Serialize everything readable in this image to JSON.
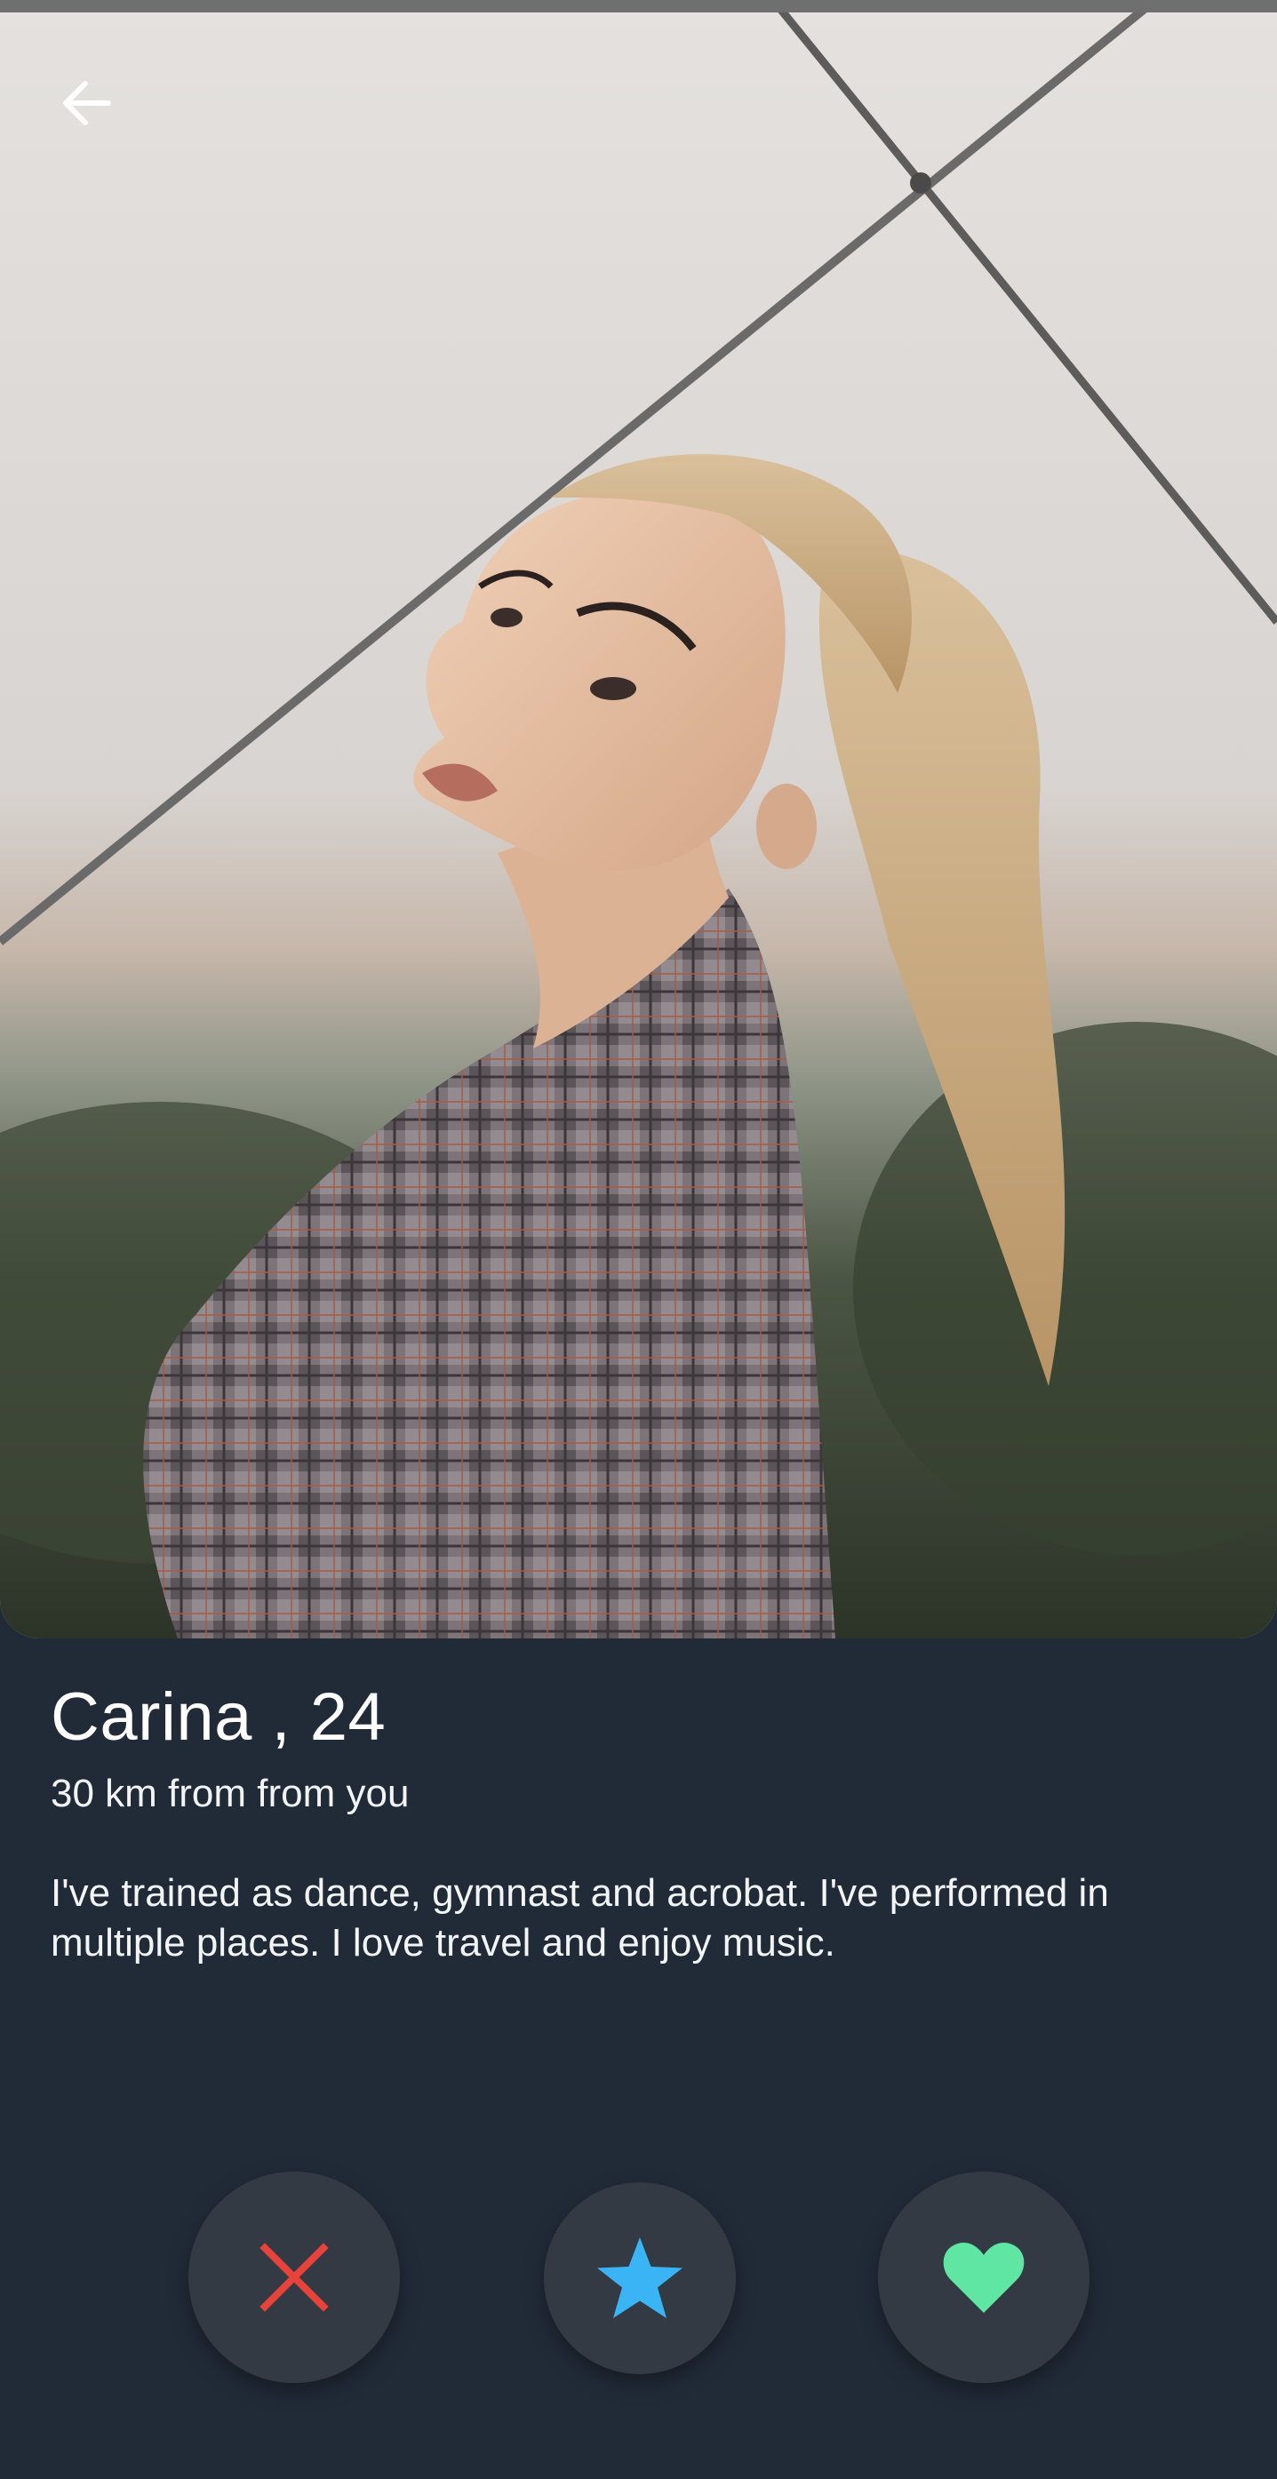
{
  "profile": {
    "name_age": "Carina , 24",
    "distance": "30 km from from you",
    "bio": "I've trained as dance, gymnast and acrobat. I've performed in multiple places. I love travel and enjoy music."
  },
  "icons": {
    "back": "arrow-left-icon",
    "dislike": "close-icon",
    "superlike": "star-icon",
    "like": "heart-icon"
  },
  "colors": {
    "background": "#212b38",
    "button_background": "#333a44",
    "dislike": "#e8433a",
    "superlike": "#3bb4f5",
    "like": "#5fe6a2",
    "text": "#ffffff"
  }
}
